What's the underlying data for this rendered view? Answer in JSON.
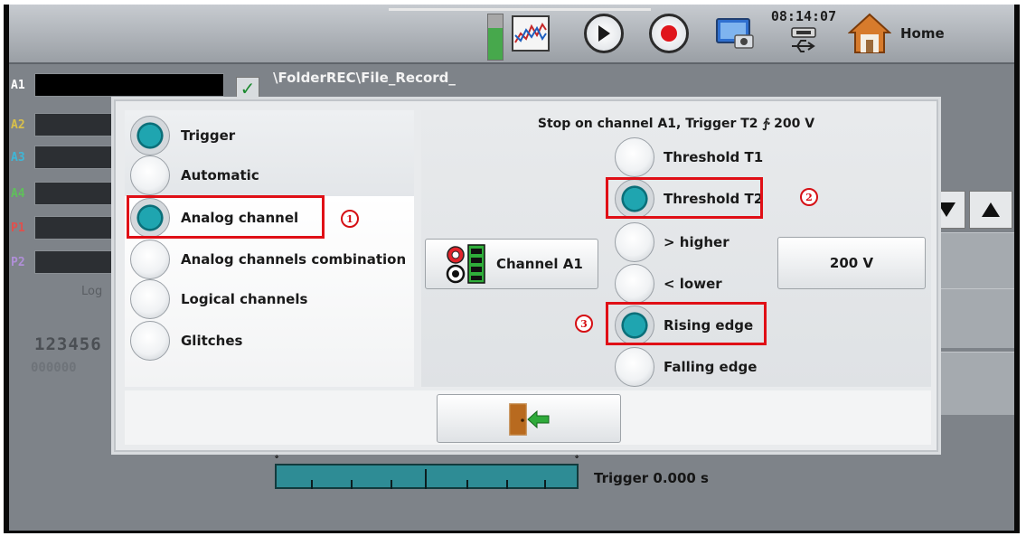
{
  "topbar": {
    "clock": "08:14:07",
    "home_label": "Home",
    "icons": [
      "level-meter-icon",
      "graph-icon",
      "play-icon",
      "record-icon",
      "screenshot-icon",
      "usb-icon",
      "home-icon"
    ]
  },
  "background": {
    "channels": [
      "A1",
      "A2",
      "A3",
      "A4",
      "P1",
      "P2"
    ],
    "record_path": "\\FolderREC\\File_Record_",
    "logical_fragment": "Log",
    "digits": "123456",
    "zeros": "000000",
    "trigger_time": "Trigger 0.000 s"
  },
  "dialog": {
    "trigger_mode": [
      {
        "label": "Trigger",
        "selected": true
      },
      {
        "label": "Automatic",
        "selected": false
      }
    ],
    "trigger_type": [
      {
        "label": "Analog channel",
        "selected": true
      },
      {
        "label": "Analog channels combination",
        "selected": false
      },
      {
        "label": "Logical channels",
        "selected": false
      },
      {
        "label": "Glitches",
        "selected": false
      }
    ],
    "summary": "Stop on channel A1, Trigger T2 ∱ 200 V",
    "channel_button_label": "Channel A1",
    "thresholds": [
      {
        "label": "Threshold T1",
        "selected": false
      },
      {
        "label": "Threshold T2",
        "selected": true
      }
    ],
    "conditions": [
      {
        "label": "> higher",
        "selected": false
      },
      {
        "label": "< lower",
        "selected": false
      },
      {
        "label": "Rising edge",
        "selected": true
      },
      {
        "label": "Falling edge",
        "selected": false
      }
    ],
    "value_button_label": "200 V",
    "exit_icon": "exit-door-icon"
  },
  "annotations": [
    "1",
    "2",
    "3"
  ],
  "colors": {
    "accent_teal": "#1fa5b0",
    "highlight_red": "#e00f16"
  }
}
